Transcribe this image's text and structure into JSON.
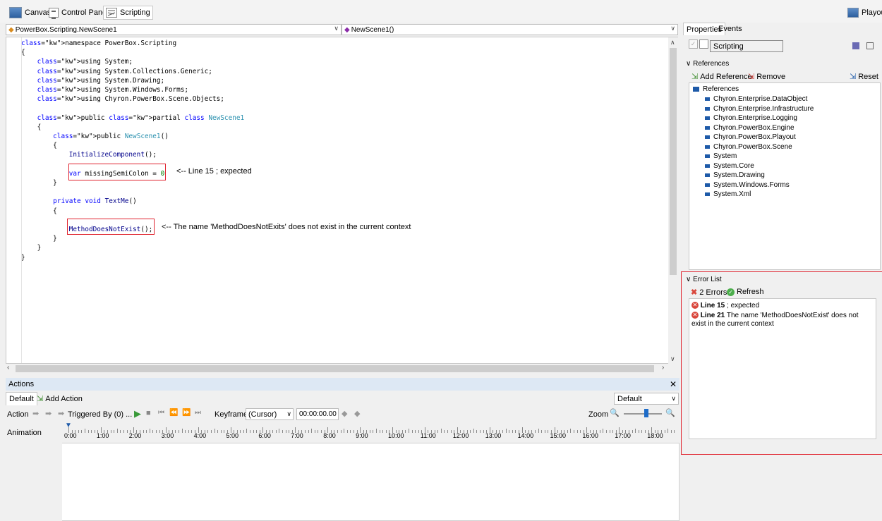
{
  "top_tabs": [
    {
      "label": "Canvas",
      "icon": "canvas-icon"
    },
    {
      "label": "Control Panel",
      "icon": "control-panel-icon"
    },
    {
      "label": "Scripting",
      "icon": "scripting-icon"
    }
  ],
  "playout_label": "Playout",
  "class_combo": "PowerBox.Scripting.NewScene1",
  "member_combo": "NewScene1()",
  "code_lines": [
    "namespace PowerBox.Scripting",
    "{",
    "    using System;",
    "    using System.Collections.Generic;",
    "    using System.Drawing;",
    "    using System.Windows.Forms;",
    "    using Chyron.PowerBox.Scene.Objects;",
    "",
    "    public partial class NewScene1",
    "    {",
    "        public NewScene1()",
    "        {",
    "            InitializeComponent();",
    "",
    "            var missingSemiColon = 0",
    "        }",
    "",
    "        private void TextMe()",
    "        {",
    "",
    "            MethodDoesNotExist();",
    "        }",
    "    }",
    "}"
  ],
  "annotations": {
    "line15": "<-- Line 15 ; expected",
    "line21": "<-- The name 'MethodDoesNotExits' does not exist in the current context"
  },
  "actions": {
    "header": "Actions",
    "tab_default": "Default",
    "add_action": "Add Action",
    "preset_select": "Default",
    "toolbar": {
      "action_label": "Action",
      "triggered_by": "Triggered By (0) ...",
      "keyframe_label": "Keyframe",
      "keyframe_value": "(Cursor)",
      "time_value": "00:00:00.00",
      "zoom_label": "Zoom"
    },
    "animation_label": "Animation",
    "timeline_labels": [
      "0:00",
      "1:00",
      "2:00",
      "3:00",
      "4:00",
      "5:00",
      "6:00",
      "7:00",
      "8:00",
      "9:00",
      "10:00",
      "11:00",
      "12:00",
      "13:00",
      "14:00",
      "15:00",
      "16:00",
      "17:00",
      "18:00"
    ]
  },
  "right_panel": {
    "tabs": [
      "Properties",
      "Events"
    ],
    "name_field": "Scripting",
    "references_header": "References",
    "add_reference": "Add Reference",
    "remove": "Remove",
    "reset": "Reset",
    "tree_root": "References",
    "references": [
      "Chyron.Enterprise.DataObject",
      "Chyron.Enterprise.Infrastructure",
      "Chyron.Enterprise.Logging",
      "Chyron.PowerBox.Engine",
      "Chyron.PowerBox.Playout",
      "Chyron.PowerBox.Scene",
      "System",
      "System.Core",
      "System.Drawing",
      "System.Windows.Forms",
      "System.Xml"
    ],
    "error_list": {
      "header": "Error List",
      "count_label": "2 Errors",
      "refresh": "Refresh",
      "errors": [
        {
          "line": "Line 15",
          "message": " ; expected"
        },
        {
          "line": "Line 21",
          "message": " The name 'MethodDoesNotExist' does not exist in the current context"
        }
      ]
    }
  },
  "colors": {
    "keyword": "#0000ff",
    "type": "#2b91af",
    "error_red": "#e0232e",
    "header_blue": "#dde8f4"
  }
}
